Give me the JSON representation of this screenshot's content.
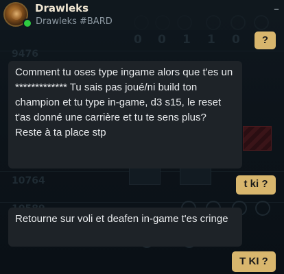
{
  "header": {
    "name": "Drawleks",
    "tag": "Drawleks #BARD",
    "minimize": "–"
  },
  "background": {
    "numbers": [
      "9476",
      "10764",
      "10589",
      "0",
      "0",
      "1",
      "1",
      "0"
    ]
  },
  "messages": [
    {
      "dir": "out",
      "text": "?"
    },
    {
      "dir": "in",
      "text": "Comment tu oses type ingame alors que t'es un ************* Tu sais pas joué/ni build ton champion et tu type in-game, d3 s15, le reset t'as donné une carrière et tu te sens plus? Reste à ta place stp"
    },
    {
      "dir": "out",
      "text": "t ki ?"
    },
    {
      "dir": "in",
      "text": "Retourne sur voli et deafen in-game t'es cringe"
    },
    {
      "dir": "out",
      "text": "T KI ?"
    }
  ],
  "colors": {
    "incoming_bubble": "#1e2328",
    "outgoing_bubble": "#d8b66d",
    "online": "#2ecc40",
    "name": "#f0e6d2"
  }
}
